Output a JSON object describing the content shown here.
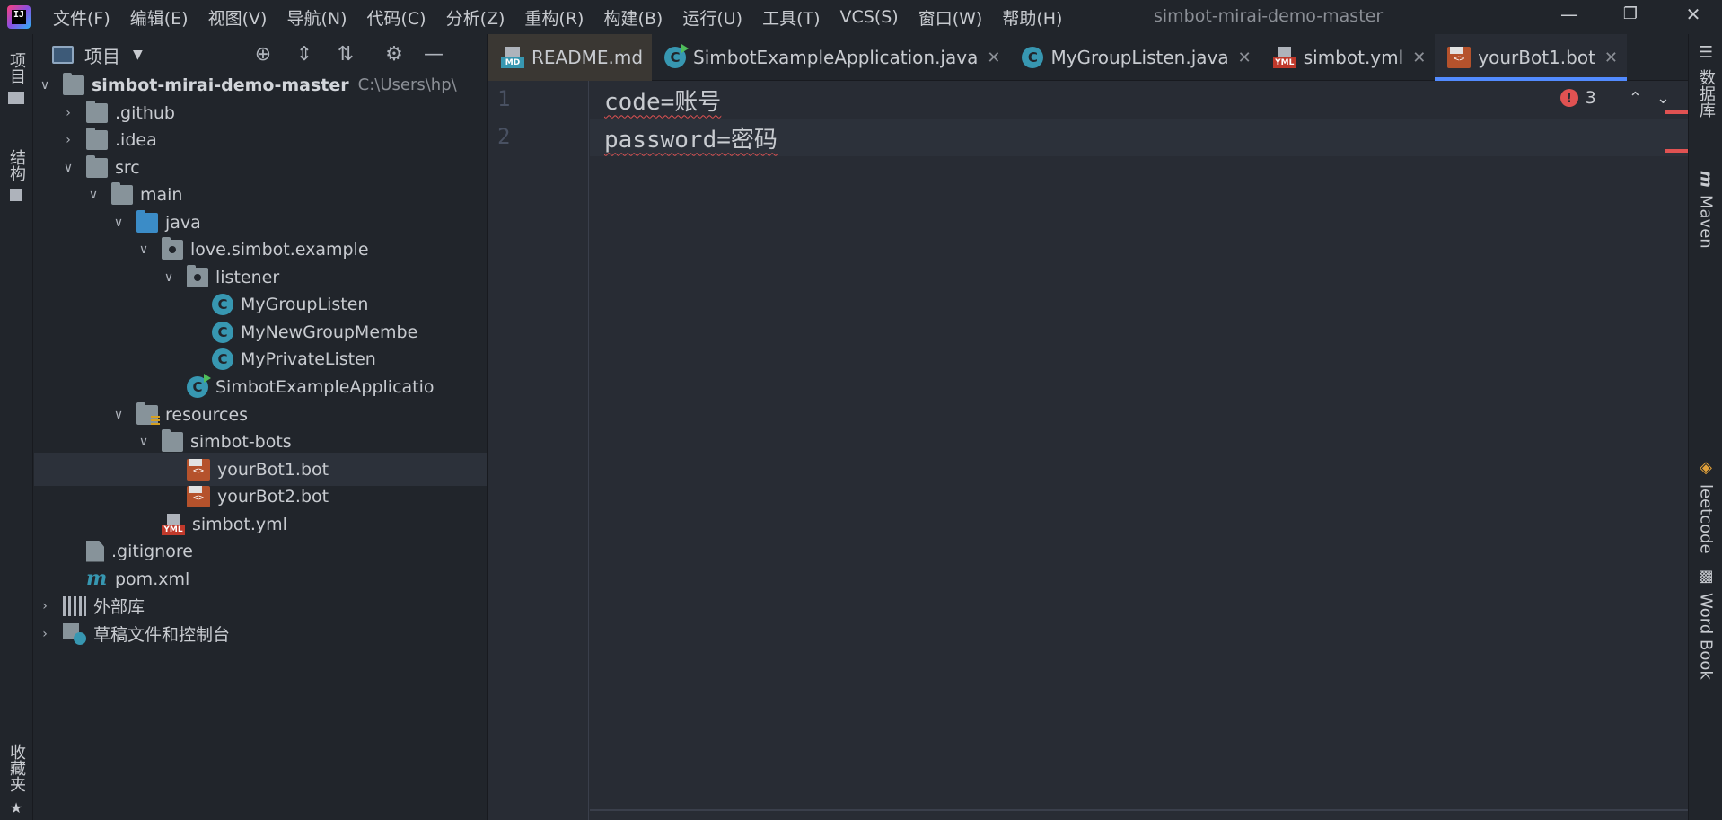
{
  "app": {
    "window_title": "simbot-mirai-demo-master"
  },
  "menu": [
    "文件(F)",
    "编辑(E)",
    "视图(V)",
    "导航(N)",
    "代码(C)",
    "分析(Z)",
    "重构(R)",
    "构建(B)",
    "运行(U)",
    "工具(T)",
    "VCS(S)",
    "窗口(W)",
    "帮助(H)"
  ],
  "left_strip": {
    "project_tab": "项目",
    "structure_tab": "结构",
    "favorites_tab": "收藏夹"
  },
  "project_panel": {
    "title": "项目",
    "tree": [
      {
        "label": "simbot-mirai-demo-master",
        "path": "C:\\Users\\hp\\",
        "icon": "module-folder-icon",
        "bold": true
      },
      {
        "label": ".github",
        "icon": "folder-icon"
      },
      {
        "label": ".idea",
        "icon": "folder-icon"
      },
      {
        "label": "src",
        "icon": "folder-icon"
      },
      {
        "label": "main",
        "icon": "folder-icon"
      },
      {
        "label": "java",
        "icon": "source-folder-icon"
      },
      {
        "label": "love.simbot.example",
        "icon": "package-icon"
      },
      {
        "label": "listener",
        "icon": "package-icon"
      },
      {
        "label": "MyGroupListen",
        "icon": "class-icon"
      },
      {
        "label": "MyNewGroupMembe",
        "icon": "class-icon"
      },
      {
        "label": "MyPrivateListen",
        "icon": "class-icon"
      },
      {
        "label": "SimbotExampleApplicatio",
        "icon": "runnable-class-icon"
      },
      {
        "label": "resources",
        "icon": "resources-folder-icon"
      },
      {
        "label": "simbot-bots",
        "icon": "folder-icon"
      },
      {
        "label": "yourBot1.bot",
        "icon": "bot-file-icon",
        "selected": true
      },
      {
        "label": "yourBot2.bot",
        "icon": "bot-file-icon"
      },
      {
        "label": "simbot.yml",
        "icon": "yml-file-icon"
      },
      {
        "label": ".gitignore",
        "icon": "ignore-file-icon"
      },
      {
        "label": "pom.xml",
        "icon": "maven-icon"
      },
      {
        "label": "外部库",
        "icon": "library-icon"
      },
      {
        "label": "草稿文件和控制台",
        "icon": "scratch-icon"
      }
    ]
  },
  "tabs": [
    {
      "label": "README.md",
      "icon": "markdown-icon"
    },
    {
      "label": "SimbotExampleApplication.java",
      "icon": "runnable-class-icon"
    },
    {
      "label": "MyGroupListen.java",
      "icon": "class-icon"
    },
    {
      "label": "simbot.yml",
      "icon": "yml-file-icon"
    },
    {
      "label": "yourBot1.bot",
      "icon": "bot-file-icon",
      "active": true
    }
  ],
  "editor": {
    "lines": [
      {
        "number": "1",
        "text": "code=账号"
      },
      {
        "number": "2",
        "text": "password=密码"
      }
    ],
    "error_count": "3"
  },
  "right_strip": {
    "database_tab": "数据库",
    "maven_tab": "Maven",
    "leetcode_tab": "leetcode",
    "wordbook_tab": "Word Book"
  },
  "colors": {
    "accent": "#528bff",
    "error": "#e05252",
    "class_icon": "#3797b1",
    "background": "#21252b",
    "editor_background": "#282c34"
  }
}
